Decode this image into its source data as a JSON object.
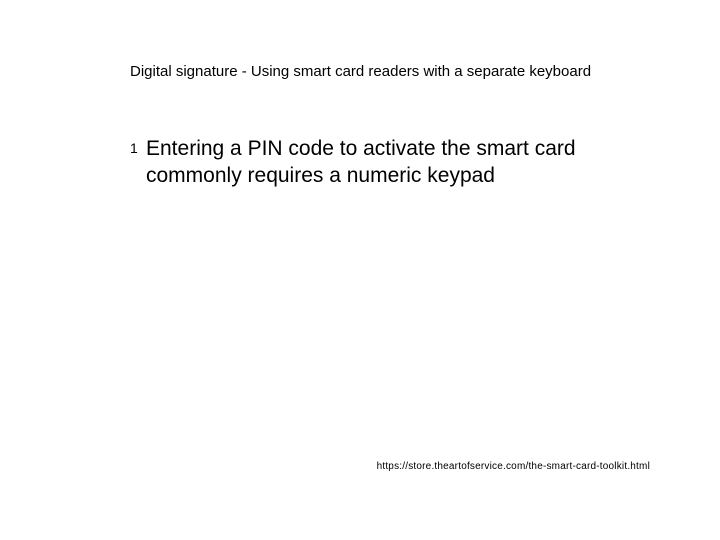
{
  "slide": {
    "title": "Digital signature - Using smart card readers with a separate keyboard",
    "bullets": [
      {
        "number": "1",
        "text": "Entering a PIN code to activate the smart card commonly requires a numeric keypad"
      }
    ],
    "footer_url": "https://store.theartofservice.com/the-smart-card-toolkit.html"
  }
}
